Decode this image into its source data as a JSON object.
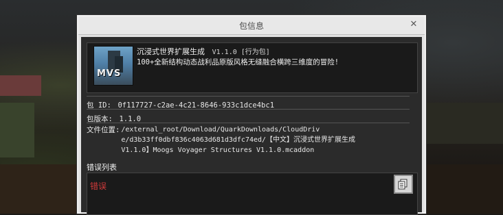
{
  "dialog": {
    "title": "包信息",
    "close_icon": "✕"
  },
  "pack": {
    "icon_label": "MVS",
    "name": "沉浸式世界扩展生成",
    "version_tag": "V1.1.0 [行为包]",
    "description": "100+全新结构动态战利品原版风格无缝融合横跨三维度的冒险!"
  },
  "info": {
    "id_label": "包 ID:",
    "id_value": "0f117727-c2ae-4c21-8646-933c1dce4bc1",
    "version_label": "包版本:",
    "version_value": "1.1.0",
    "location_label": "文件位置:",
    "location_lines": [
      "/external_root/Download/QuarkDownloads/CloudDriv",
      "e/d3b33ff0dbf836c4063d681d3dfc74ed/【中文】沉浸式世界扩展生成",
      "V1.1.0】Moogs Voyager Structures V1.1.0.mcaddon"
    ]
  },
  "errors": {
    "title": "错误列表",
    "label": "错误",
    "copy_icon": "copy-icon"
  },
  "colors": {
    "error": "#d13a3a",
    "panel_bg": "#1a1a1a",
    "dialog_frame": "#e2e2e2"
  }
}
